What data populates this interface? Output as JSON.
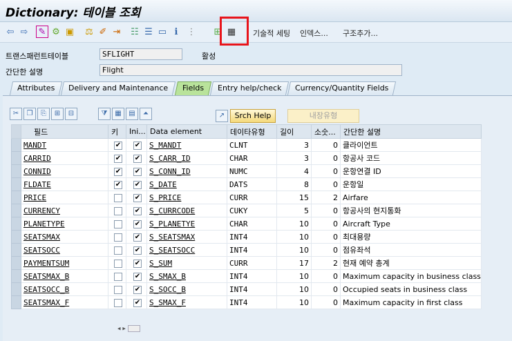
{
  "title": "Dictionary: 테이블 조회",
  "toolbar": {
    "text_buttons": [
      "기술적 세팅",
      "인덱스...",
      "구조추가..."
    ]
  },
  "header": {
    "table_label": "트랜스패런트테이블",
    "table_value": "SFLIGHT",
    "status": "활성",
    "desc_label": "간단한 설명",
    "desc_value": "Flight"
  },
  "tabs": [
    "Attributes",
    "Delivery and Maintenance",
    "Fields",
    "Entry help/check",
    "Currency/Quantity Fields"
  ],
  "active_tab": "Fields",
  "grid_buttons": {
    "srch_help": "Srch Help",
    "builtin_type": "내장유형"
  },
  "columns": [
    "필드",
    "키",
    "Ini...",
    "Data element",
    "데이타유형",
    "길이",
    "소숫...",
    "간단한 설명"
  ],
  "rows": [
    {
      "field": "MANDT",
      "key": true,
      "ini": true,
      "elem": "S_MANDT",
      "type": "CLNT",
      "len": "3",
      "dec": "0",
      "desc": "클라이언트"
    },
    {
      "field": "CARRID",
      "key": true,
      "ini": true,
      "elem": "S_CARR_ID",
      "type": "CHAR",
      "len": "3",
      "dec": "0",
      "desc": "항공사 코드"
    },
    {
      "field": "CONNID",
      "key": true,
      "ini": true,
      "elem": "S_CONN_ID",
      "type": "NUMC",
      "len": "4",
      "dec": "0",
      "desc": "운항연결 ID"
    },
    {
      "field": "FLDATE",
      "key": true,
      "ini": true,
      "elem": "S_DATE",
      "type": "DATS",
      "len": "8",
      "dec": "0",
      "desc": "운항일"
    },
    {
      "field": "PRICE",
      "key": false,
      "ini": true,
      "elem": "S_PRICE",
      "type": "CURR",
      "len": "15",
      "dec": "2",
      "desc": "Airfare"
    },
    {
      "field": "CURRENCY",
      "key": false,
      "ini": true,
      "elem": "S_CURRCODE",
      "type": "CUKY",
      "len": "5",
      "dec": "0",
      "desc": "항공사의 현지통화"
    },
    {
      "field": "PLANETYPE",
      "key": false,
      "ini": true,
      "elem": "S_PLANETYE",
      "type": "CHAR",
      "len": "10",
      "dec": "0",
      "desc": "Aircraft Type"
    },
    {
      "field": "SEATSMAX",
      "key": false,
      "ini": true,
      "elem": "S_SEATSMAX",
      "type": "INT4",
      "len": "10",
      "dec": "0",
      "desc": "최대용량"
    },
    {
      "field": "SEATSOCC",
      "key": false,
      "ini": true,
      "elem": "S_SEATSOCC",
      "type": "INT4",
      "len": "10",
      "dec": "0",
      "desc": "점유좌석"
    },
    {
      "field": "PAYMENTSUM",
      "key": false,
      "ini": true,
      "elem": "S_SUM",
      "type": "CURR",
      "len": "17",
      "dec": "2",
      "desc": "현재 예약 총계"
    },
    {
      "field": "SEATSMAX_B",
      "key": false,
      "ini": true,
      "elem": "S_SMAX_B",
      "type": "INT4",
      "len": "10",
      "dec": "0",
      "desc": "Maximum capacity in business class"
    },
    {
      "field": "SEATSOCC_B",
      "key": false,
      "ini": true,
      "elem": "S_SOCC_B",
      "type": "INT4",
      "len": "10",
      "dec": "0",
      "desc": "Occupied seats in business class"
    },
    {
      "field": "SEATSMAX_F",
      "key": false,
      "ini": true,
      "elem": "S_SMAX_F",
      "type": "INT4",
      "len": "10",
      "dec": "0",
      "desc": "Maximum capacity in first class"
    }
  ]
}
